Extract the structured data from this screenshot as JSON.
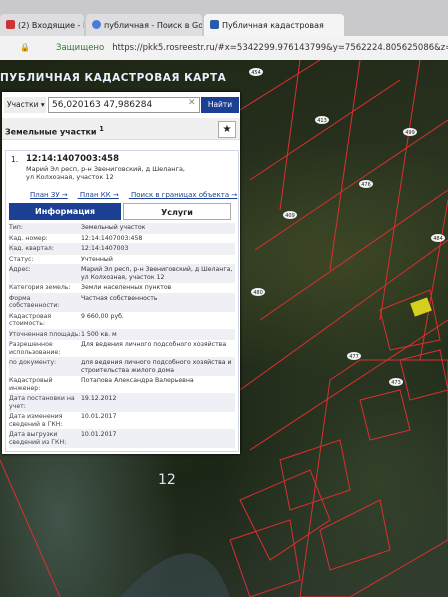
{
  "browser": {
    "tabs": [
      {
        "label": "(2) Входящие - Почт"
      },
      {
        "label": "публичная - Поиск в Go"
      },
      {
        "label": "Публичная кадастровая"
      }
    ],
    "secure_label": "Защищено",
    "url": "https://pkk5.rosreestr.ru/#x=5342299.976143799&y=7562224.805625086&z=16&text=56%2C0"
  },
  "map": {
    "title": "ПУБЛИЧНАЯ КАДАСТРОВАЯ КАРТА",
    "district_number": "12",
    "labels": [
      "454",
      "413",
      "409",
      "476",
      "499",
      "484",
      "480",
      "477",
      "473",
      "412",
      "513",
      "517",
      "5"
    ]
  },
  "panel": {
    "search_type": "Участки",
    "search_value": "56,020163 47,986284",
    "find_label": "Найти",
    "section_title": "Земельные участки",
    "section_count": "1",
    "item_number": "1.",
    "cad_number": "12:14:1407003:458",
    "address": "Марий Эл респ, р-н Звениговский, д Шеланга, ул Колхозная, участок 12",
    "links": [
      "План ЗУ",
      "План КК",
      "Поиск в границах объекта"
    ],
    "tab_info": "Информация",
    "tab_services": "Услуги",
    "rows": [
      {
        "k": "Тип:",
        "v": "Земельный участок"
      },
      {
        "k": "Кад. номер:",
        "v": "12:14:1407003:458"
      },
      {
        "k": "Кад. квартал:",
        "v": "12:14:1407003"
      },
      {
        "k": "Статус:",
        "v": "Учтенный"
      },
      {
        "k": "Адрес:",
        "v": "Марий Эл респ, р-н Звениговский, д Шеланга, ул Колхозная, участок 12"
      },
      {
        "k": "Категория земель:",
        "v": "Земли населенных пунктов"
      },
      {
        "k": "Форма собственности:",
        "v": "Частная собственность"
      },
      {
        "k": "Кадастровая стоимость:",
        "v": "9 660,00 руб."
      },
      {
        "k": "Уточненная площадь:",
        "v": "1 500 кв. м"
      },
      {
        "k": "Разрешенное использование:",
        "v": "Для ведения личного подсобного хозяйства"
      },
      {
        "k": "по документу:",
        "v": "для ведения личного подсобного хозяйства и строительства жилого дома"
      },
      {
        "k": "Кадастровый инженер:",
        "v": "Потапова Александра Валерьевна"
      },
      {
        "k": "Дата постановки на учет:",
        "v": "19.12.2012"
      },
      {
        "k": "Дата изменения сведений в ГКН:",
        "v": "10.01.2017"
      },
      {
        "k": "Дата выгрузки сведений из ГКН:",
        "v": "10.01.2017"
      }
    ]
  }
}
